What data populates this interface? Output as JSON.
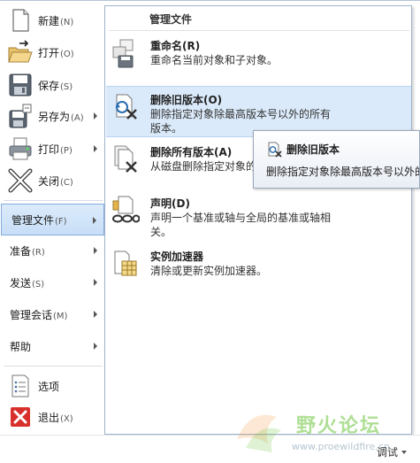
{
  "left_menu": {
    "items": [
      {
        "label": "新建",
        "key": "(N)"
      },
      {
        "label": "打开",
        "key": "(O)"
      },
      {
        "label": "保存",
        "key": "(S)"
      },
      {
        "label": "另存为",
        "key": "(A)"
      },
      {
        "label": "打印",
        "key": "(P)"
      },
      {
        "label": "关闭",
        "key": "(C)"
      },
      {
        "label": "管理文件",
        "key": "(F)"
      },
      {
        "label": "准备",
        "key": "(R)"
      },
      {
        "label": "发送",
        "key": "(S)"
      },
      {
        "label": "管理会话",
        "key": "(M)"
      },
      {
        "label": "帮助",
        "key": ""
      },
      {
        "label": "选项",
        "key": ""
      },
      {
        "label": "退出",
        "key": "(X)"
      }
    ]
  },
  "submenu": {
    "title": "管理文件",
    "items": [
      {
        "title": "重命名(R)",
        "desc": "重命名当前对象和子对象。"
      },
      {
        "title": "删除旧版本(O)",
        "desc": "删除指定对象除最高版本号以外的所有版本。"
      },
      {
        "title": "删除所有版本(A)",
        "desc": "从磁盘删除指定对象的"
      },
      {
        "title": "声明(D)",
        "desc": "声明一个基准或轴与全局的基准或轴相关。"
      },
      {
        "title": "实例加速器",
        "desc": "清除或更新实例加速器。"
      }
    ]
  },
  "tooltip": {
    "title": "删除旧版本",
    "desc": "删除指定对象除最高版本号以外的"
  },
  "status": {
    "debug_label": "调试"
  },
  "watermark": {
    "main": "野火论坛",
    "url": "www.proewildfire.cn"
  },
  "colors": {
    "selection_bg": "#c7def7",
    "selection_border": "#84acdd",
    "hover_bg": "#dbeafa",
    "watermark_green": "#6cc43c",
    "exit_red": "#d8302c"
  },
  "icons": [
    "new-file-icon",
    "open-folder-icon",
    "save-disk-icon",
    "save-as-icon",
    "printer-icon",
    "close-x-icon",
    "options-list-icon",
    "exit-x-icon",
    "rename-icon",
    "delete-old-versions-icon",
    "delete-all-versions-icon",
    "declare-icon",
    "instance-accelerator-icon"
  ]
}
